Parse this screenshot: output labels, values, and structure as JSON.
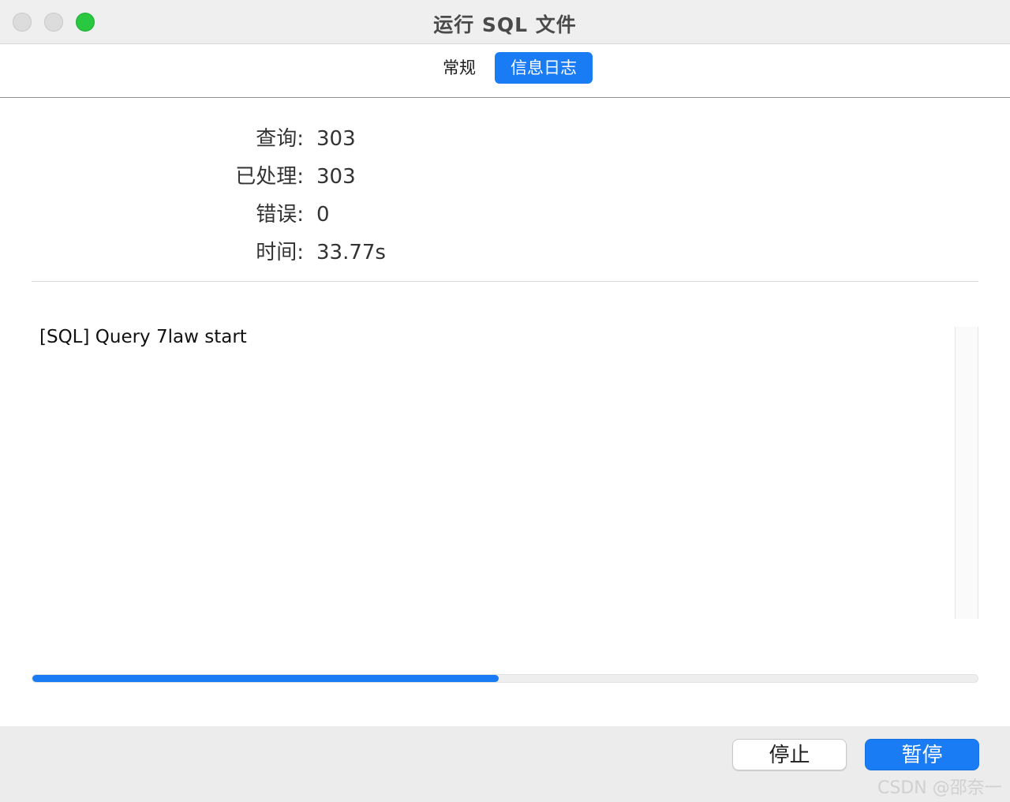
{
  "window": {
    "title": "运行 SQL 文件",
    "traffic_lights": [
      "close",
      "minimize",
      "zoom"
    ]
  },
  "tabs": [
    {
      "label": "常规",
      "selected": false
    },
    {
      "label": "信息日志",
      "selected": true
    }
  ],
  "stats": [
    {
      "label": "查询:",
      "value": "303"
    },
    {
      "label": "已处理:",
      "value": "303"
    },
    {
      "label": "错误:",
      "value": "0"
    },
    {
      "label": "时间:",
      "value": "33.77s"
    }
  ],
  "log": {
    "lines": [
      "[SQL] Query 7law start"
    ]
  },
  "progress": {
    "fraction": 0.493
  },
  "buttons": {
    "stop": "停止",
    "pause": "暂停"
  },
  "watermark": "CSDN @邵奈一",
  "colors": {
    "accent": "#1a7cf5",
    "zoom_green": "#29c840",
    "footer_bg": "#ececec"
  }
}
